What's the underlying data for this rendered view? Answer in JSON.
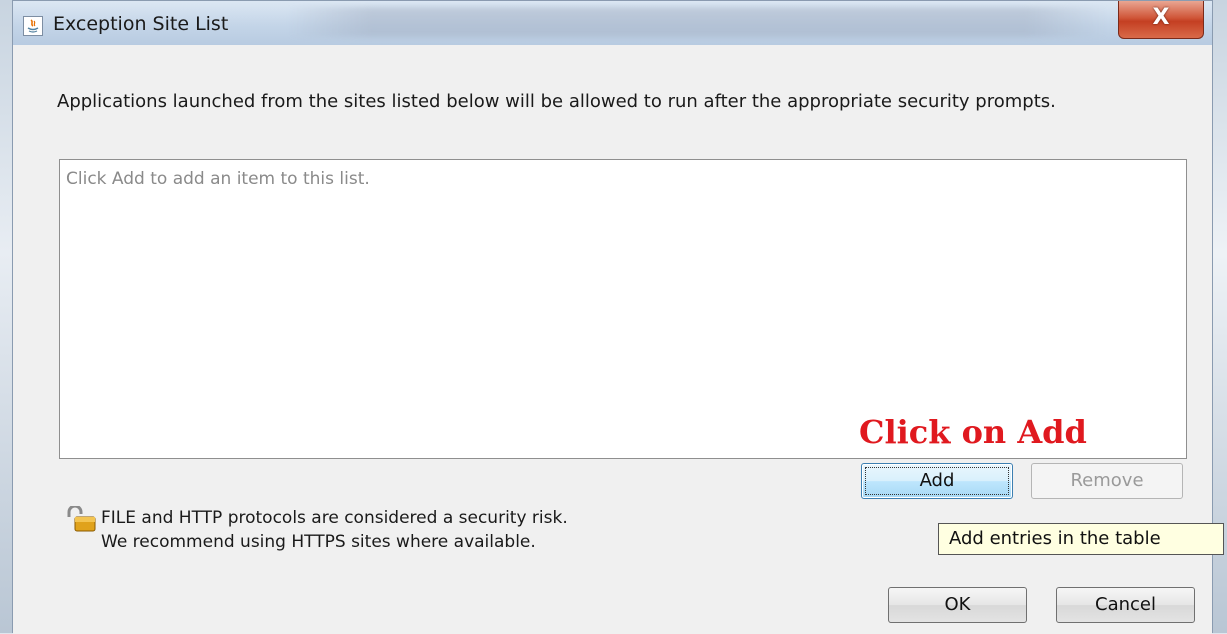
{
  "window": {
    "title": "Exception Site List",
    "close_label": "X"
  },
  "dialog": {
    "description": "Applications launched from the sites listed below will be allowed to run after the appropriate security prompts.",
    "list_placeholder": "Click Add to add an item to this list.",
    "annotation": "Click on Add",
    "add_label": "Add",
    "remove_label": "Remove",
    "tooltip": "Add entries in the table",
    "security_note_line1": "FILE and HTTP protocols are considered a security risk.",
    "security_note_line2": "We recommend using HTTPS sites where available.",
    "ok_label": "OK",
    "cancel_label": "Cancel"
  },
  "colors": {
    "annotation": "#e0191f",
    "tooltip_bg": "#ffffe1",
    "add_button_focus": "#bee6fd"
  },
  "icons": {
    "app": "java-icon",
    "close": "close-icon",
    "lock": "padlock-icon"
  }
}
